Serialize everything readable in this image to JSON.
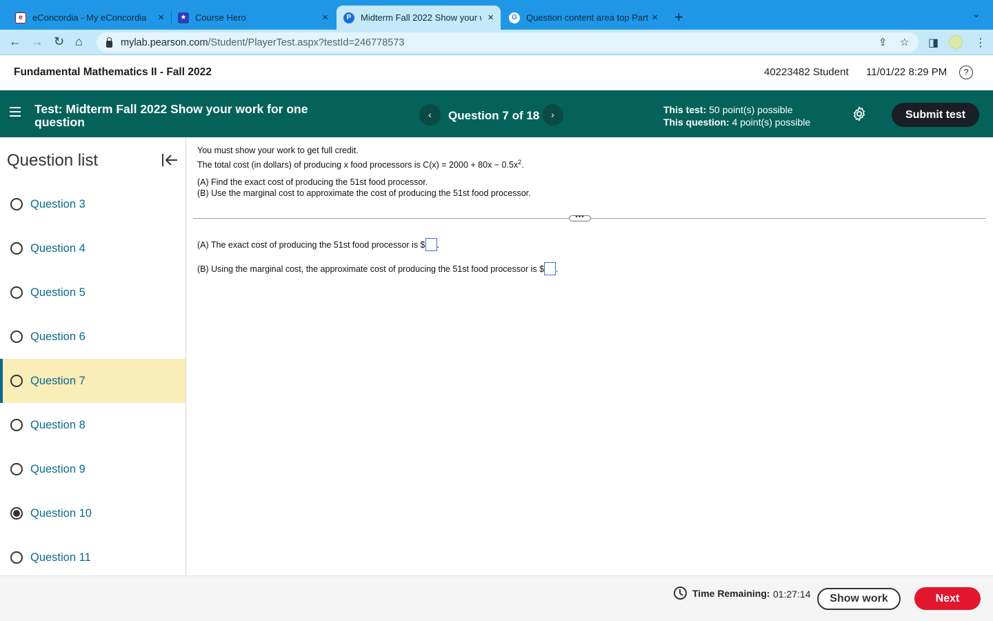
{
  "browser": {
    "tabs": [
      {
        "title": "eConcordia - My eConcordia",
        "close": "×"
      },
      {
        "title": "Course Hero",
        "close": "×"
      },
      {
        "title": "Midterm Fall 2022 Show your w",
        "close": "×"
      },
      {
        "title": "Question content area top Part",
        "close": "×"
      }
    ],
    "new_tab": "+",
    "url_host": "mylab.pearson.com",
    "url_path": "/Student/PlayerTest.aspx?testId=246778573"
  },
  "header": {
    "course_title": "Fundamental Mathematics II - Fall 2022",
    "student": "40223482 Student",
    "datetime": "11/01/22 8:29 PM",
    "help": "?"
  },
  "test_bar": {
    "test_label": "Test:",
    "test_name": "Midterm Fall 2022 Show your work for one question",
    "question_counter": "Question 7 of 18",
    "prev": "‹",
    "next": "›",
    "this_test_label": "This test:",
    "this_test_value": "50 point(s) possible",
    "this_question_label": "This question:",
    "this_question_value": "4 point(s) possible",
    "submit": "Submit test"
  },
  "sidebar": {
    "title": "Question list",
    "items": [
      {
        "label": "Question 3",
        "state": "unanswered"
      },
      {
        "label": "Question 4",
        "state": "unanswered"
      },
      {
        "label": "Question 5",
        "state": "unanswered"
      },
      {
        "label": "Question 6",
        "state": "unanswered"
      },
      {
        "label": "Question 7",
        "state": "current"
      },
      {
        "label": "Question 8",
        "state": "unanswered"
      },
      {
        "label": "Question 9",
        "state": "unanswered"
      },
      {
        "label": "Question 10",
        "state": "answered"
      },
      {
        "label": "Question 11",
        "state": "unanswered"
      }
    ]
  },
  "question": {
    "instruction": "You must show your work to get full credit.",
    "stem_pre": "The total cost (in dollars) of producing x food processors is C(x) = 2000 + 80x − 0.5x",
    "stem_sup": "2",
    "stem_post": ".",
    "part_a_prompt": "(A)  Find the exact cost of producing the 51st food processor.",
    "part_b_prompt": "(B)  Use the marginal cost to approximate the cost of producing the 51st food processor.",
    "more": "•••",
    "answer_a_text": "(A)  The exact cost of producing the 51st food processor is $",
    "answer_a_value": "",
    "answer_b_text": "(B)  Using the marginal cost, the approximate cost of producing the 51st food processor is $",
    "answer_b_value": "",
    "period": "."
  },
  "footer": {
    "time_label": "Time Remaining:",
    "time_value": "01:27:14",
    "show_work": "Show work",
    "next": "Next"
  },
  "colors": {
    "tabbar": "#1f97e6",
    "test_bar": "#04625a",
    "current_question_bg": "#f9edb8",
    "link": "#0a6a8f",
    "next_button": "#e3162f"
  }
}
